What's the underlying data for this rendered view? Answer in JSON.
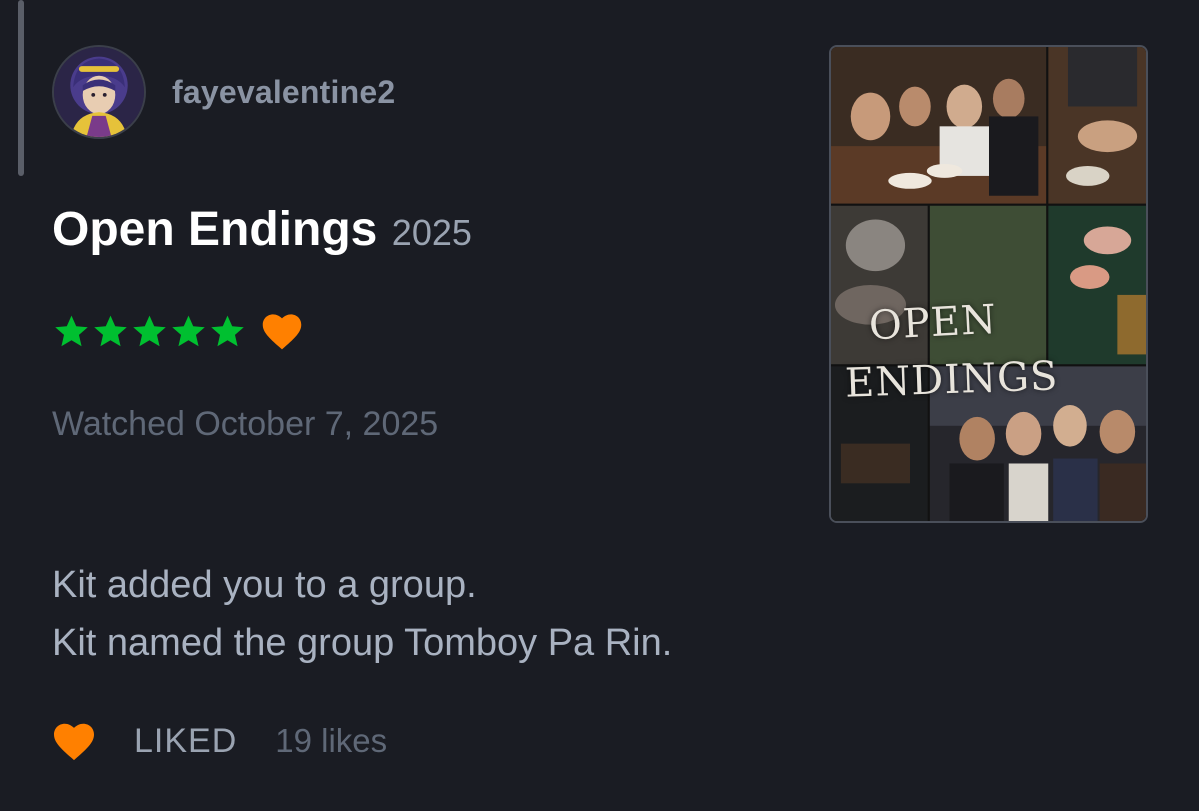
{
  "author": {
    "username": "fayevalentine2"
  },
  "film": {
    "title": "Open Endings",
    "year": "2025",
    "poster_title_line1": "OPEN",
    "poster_title_line2": "ENDINGS"
  },
  "rating": {
    "stars": 5,
    "max_stars": 5,
    "liked": true,
    "star_color": "#00c030",
    "heart_color": "#ff8000"
  },
  "watched": "Watched October 7, 2025",
  "review": {
    "lines": [
      "Kit added you to a group.",
      "Kit named the group Tomboy Pa Rin."
    ]
  },
  "footer": {
    "liked_label": "LIKED",
    "likes_count": "19 likes"
  },
  "icons": {
    "star": "star-icon",
    "heart": "heart-icon"
  }
}
